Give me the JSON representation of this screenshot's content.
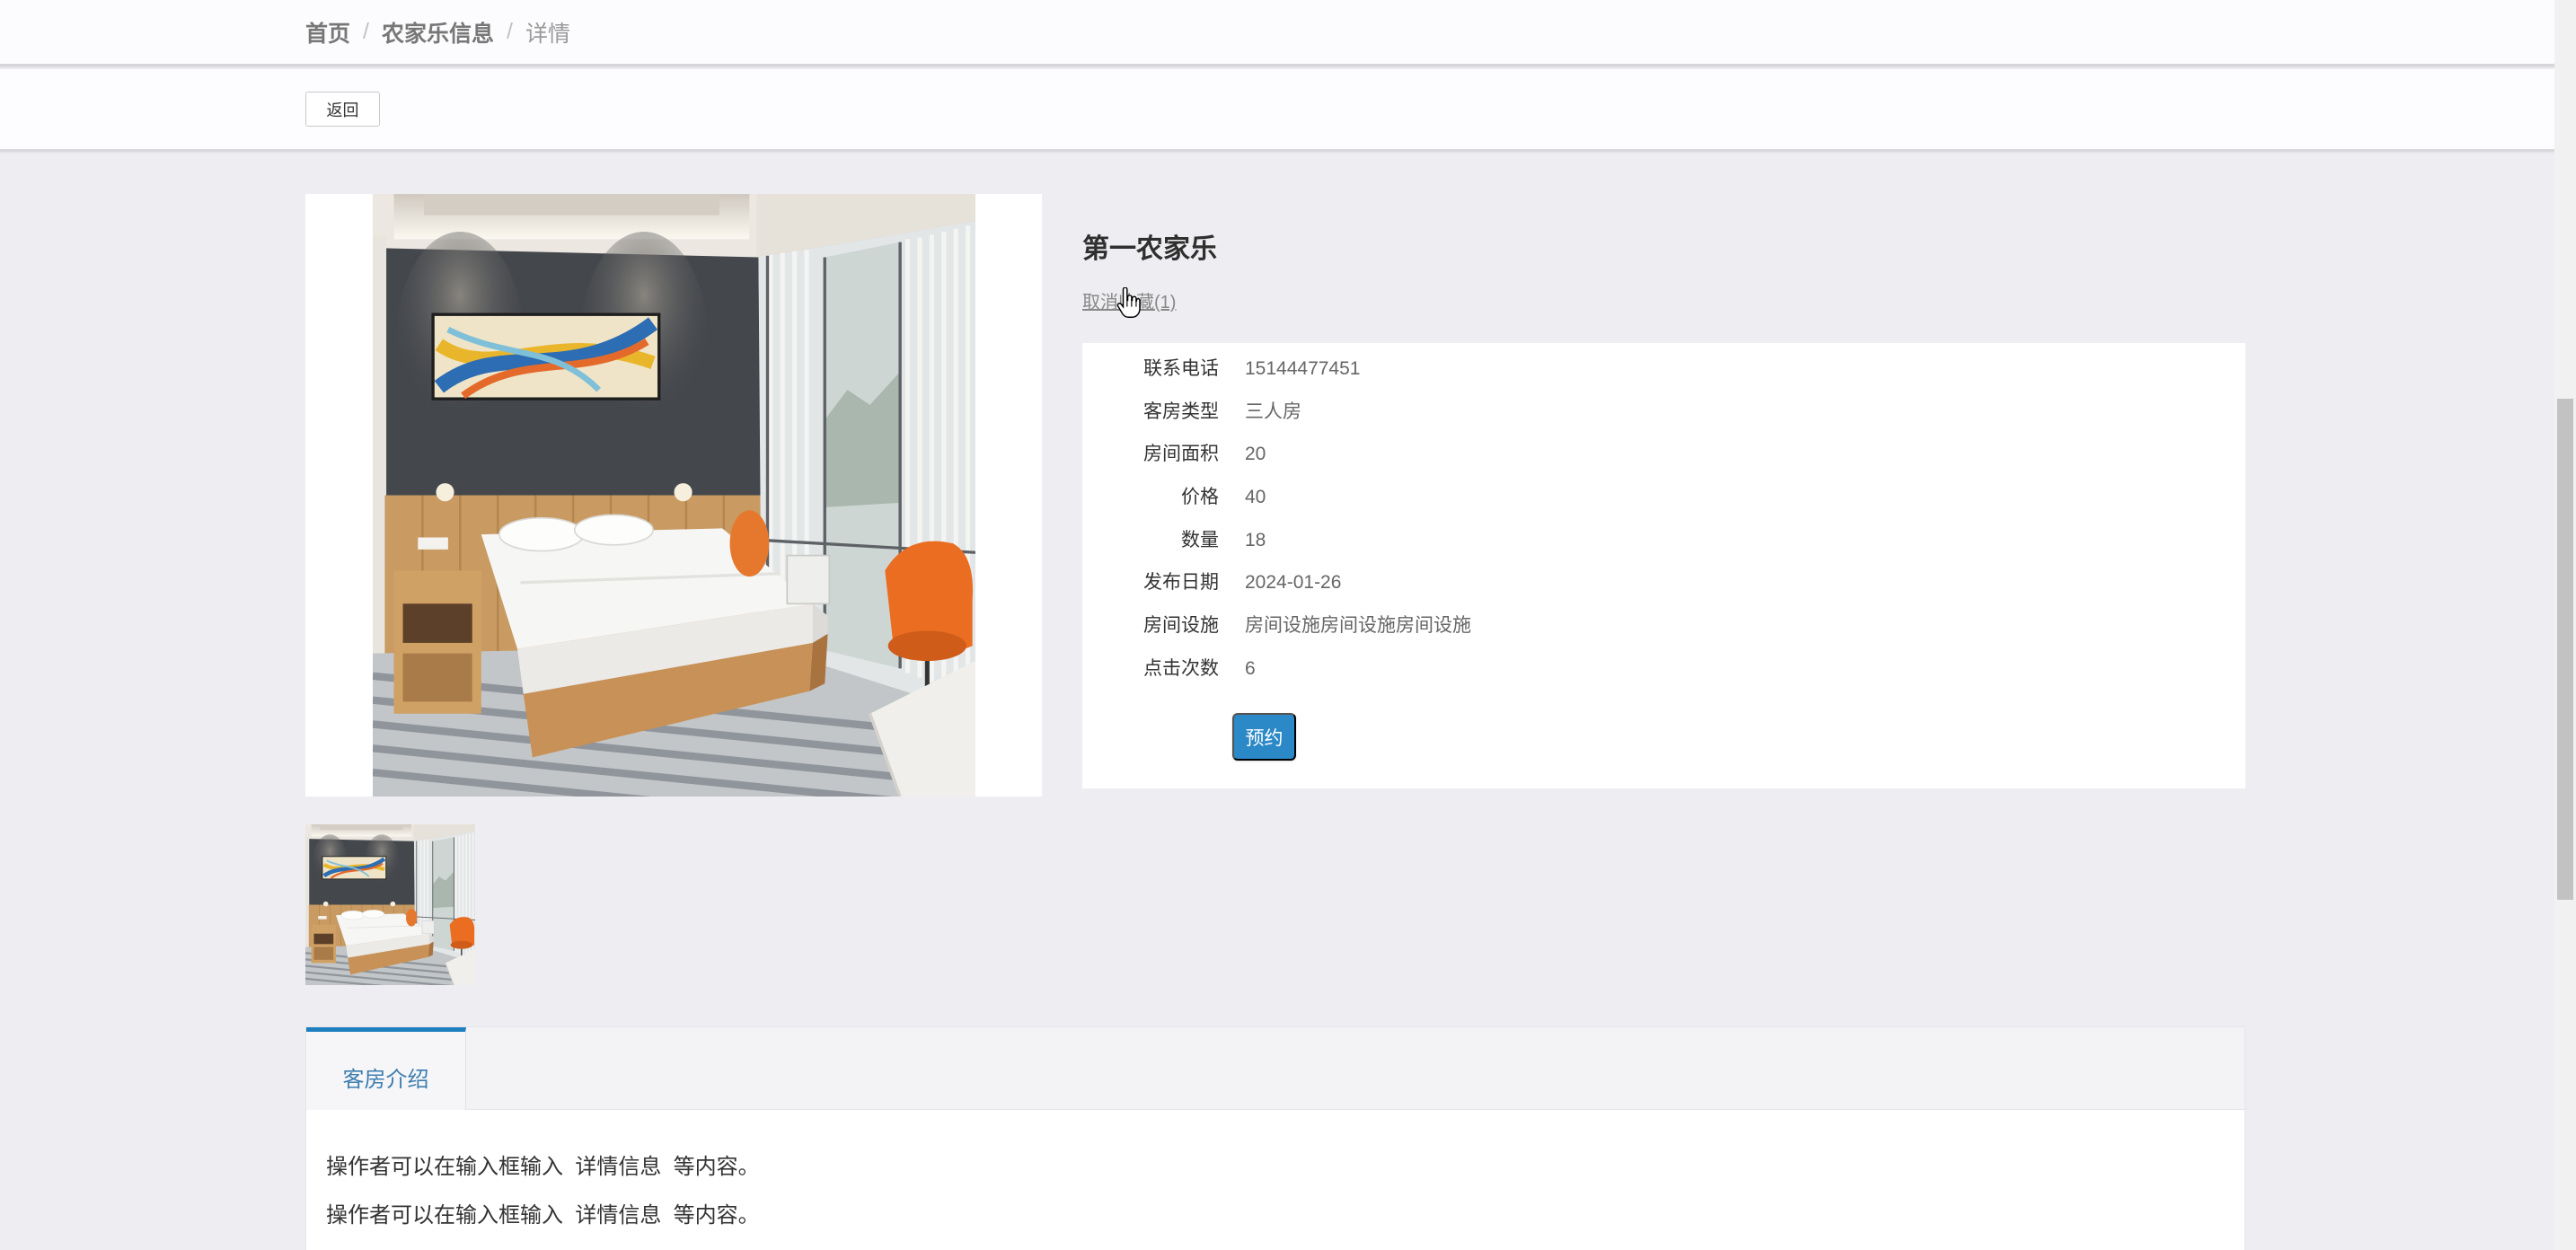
{
  "breadcrumb": {
    "items": [
      {
        "label": "首页"
      },
      {
        "label": "农家乐信息"
      },
      {
        "label": "详情"
      }
    ],
    "separator": "/"
  },
  "toolbar": {
    "back_label": "返回"
  },
  "detail": {
    "title": "第一农家乐",
    "favorite_label": "取消收藏(1)",
    "fields": [
      {
        "label": "联系电话",
        "value": "15144477451"
      },
      {
        "label": "客房类型",
        "value": "三人房"
      },
      {
        "label": "房间面积",
        "value": "20"
      },
      {
        "label": "价格",
        "value": "40"
      },
      {
        "label": "数量",
        "value": "18"
      },
      {
        "label": "发布日期",
        "value": "2024-01-26"
      },
      {
        "label": "房间设施",
        "value": "房间设施房间设施房间设施"
      },
      {
        "label": "点击次数",
        "value": "6"
      }
    ],
    "book_label": "预约"
  },
  "tabs": [
    {
      "label": "客房介绍",
      "active": true
    }
  ],
  "intro": {
    "lines": [
      "操作者可以在输入框输入  详情信息  等内容。",
      "操作者可以在输入框输入  详情信息  等内容。"
    ]
  },
  "icons": {
    "cursor": "hand-cursor-icon"
  },
  "colors": {
    "page_background": "#eeedf1",
    "accent": "#2b89c8",
    "tab_active_border": "#1d7fbf",
    "tab_text": "#3d7db0",
    "link_muted": "#888888"
  }
}
